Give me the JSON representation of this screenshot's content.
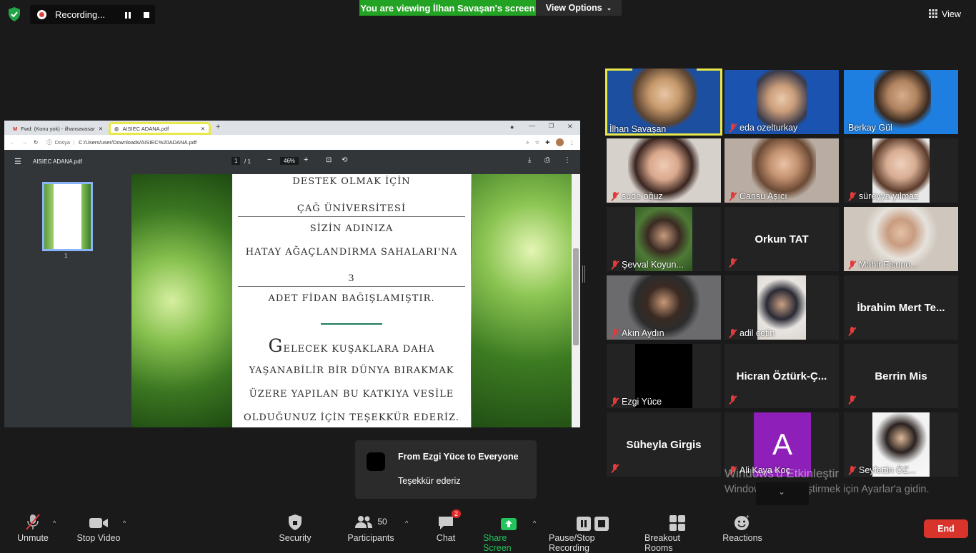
{
  "topbar": {
    "recording_label": "Recording...",
    "viewing_banner": "You are viewing İlhan Savaşan's screen",
    "view_options_label": "View Options",
    "view_label": "View"
  },
  "browser": {
    "tabs": [
      {
        "title": "Fwd: (Konu yok) - ilhansavasan@"
      },
      {
        "title": "AISIEC ADANA.pdf"
      }
    ],
    "address_prefix": "Dosya",
    "address": "C:/Users/user/Downloads/AISIEC%20ADANA.pdf",
    "pdf_title": "AISIEC ADANA.pdf",
    "page_current": "1",
    "page_total": "/ 1",
    "zoom": "46%",
    "thumb_label": "1",
    "lines": [
      "DESTEK OLMAK İÇİN",
      "ÇAĞ ÜNİVERSİTESİ",
      "SİZİN ADINIZA",
      "HATAY AĞAÇLANDIRMA SAHALARI'NA",
      "3",
      "ADET FİDAN BAĞIŞLAMIŞTIR.",
      "ELECEK KUŞAKLARA DAHA",
      "YAŞANABİLİR BİR DÜNYA BIRAKMAK",
      "ÜZERE YAPILAN BU KATKIYA VESİLE",
      "OLDUĞUNUZ İÇİN TEŞEKKÜR EDERİZ."
    ],
    "dropcap": "G"
  },
  "participants": [
    {
      "name": "İlhan Savaşan",
      "muted": false
    },
    {
      "name": "eda ozelturkay",
      "muted": true
    },
    {
      "name": "Berkay Gül",
      "muted": false
    },
    {
      "name": "sude oğuz",
      "muted": true
    },
    {
      "name": "Cansu Aşıcı",
      "muted": true
    },
    {
      "name": "süreyya yılmaz",
      "muted": true
    },
    {
      "name": "Şevval Koyun...",
      "muted": true
    },
    {
      "name": "Orkun TAT",
      "muted": true
    },
    {
      "name": "Mahir Fisuno...",
      "muted": true
    },
    {
      "name": "Akın Aydın",
      "muted": true
    },
    {
      "name": "adil çetin",
      "muted": true
    },
    {
      "name": "İbrahim  Mert  Te...",
      "muted": true
    },
    {
      "name": "Ezgi Yüce",
      "muted": true
    },
    {
      "name": "Hicran  Öztürk-Ç...",
      "muted": true
    },
    {
      "name": "Berrin Mis",
      "muted": true
    },
    {
      "name": "Süheyla Girgis",
      "muted": true
    },
    {
      "name": "Ali Kaya Koç",
      "muted": true,
      "avatar_letter": "A"
    },
    {
      "name": "Seyfettin ÖZ...",
      "muted": true
    }
  ],
  "chat_popup": {
    "from": "From Ezgi Yüce to Everyone",
    "message": "Teşekkür ederiz"
  },
  "watermark": {
    "line1": "Windows'u Etkinleştir",
    "line2": "Windows'u etkinleştirmek için Ayarlar'a gidin."
  },
  "toolbar": {
    "unmute": "Unmute",
    "stop_video": "Stop Video",
    "security": "Security",
    "participants": "Participants",
    "participants_count": "50",
    "chat": "Chat",
    "chat_badge": "2",
    "share_screen": "Share Screen",
    "pause_recording": "Pause/Stop Recording",
    "breakout": "Breakout Rooms",
    "reactions": "Reactions",
    "end": "End"
  },
  "colors": {
    "banner_green": "#23a323",
    "end_red": "#d9342b",
    "share_green": "#23c45c",
    "speaker_highlight": "#e8e84a",
    "muted_red": "#e23b3b"
  }
}
